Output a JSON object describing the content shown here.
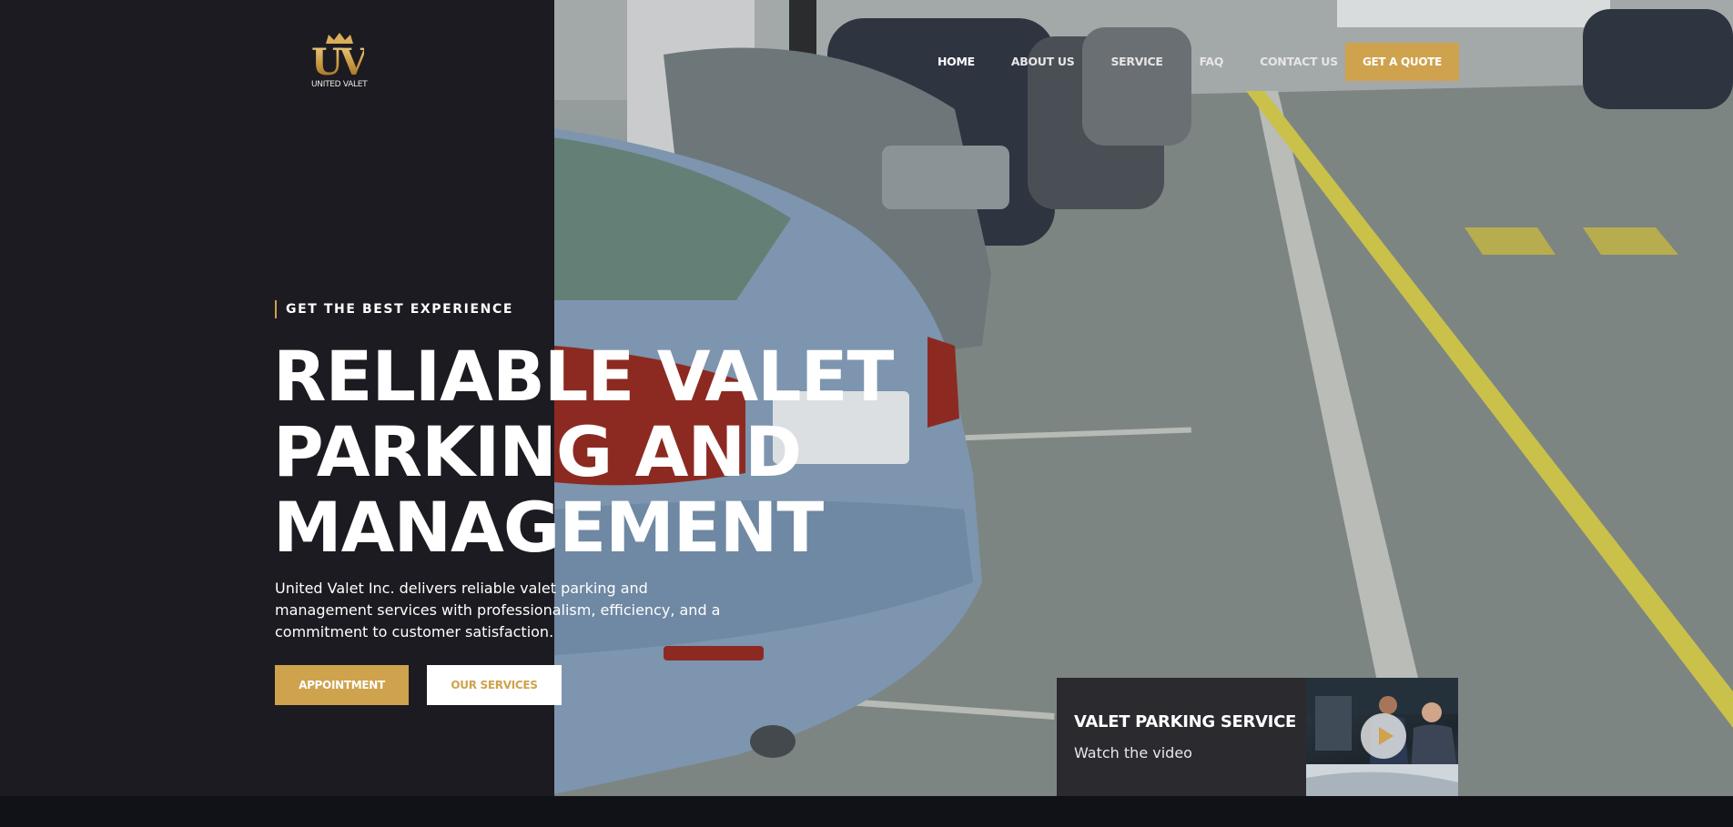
{
  "brand": {
    "logo_monogram": "UV",
    "logo_text": "UNITED VALET",
    "accent_color": "#cfa24d"
  },
  "nav": {
    "items": [
      {
        "label": "HOME",
        "active": true
      },
      {
        "label": "ABOUT US",
        "active": false
      },
      {
        "label": "SERVICE",
        "active": false
      },
      {
        "label": "FAQ",
        "active": false
      },
      {
        "label": "CONTACT US",
        "active": false
      }
    ],
    "cta_label": "GET A QUOTE"
  },
  "hero": {
    "eyebrow": "GET THE BEST EXPERIENCE",
    "headline_lines": [
      "RELIABLE VALET",
      "PARKING AND",
      "MANAGEMENT"
    ],
    "description": "United Valet Inc. delivers reliable valet parking and management services with professionalism, efficiency, and a commitment to customer satisfaction.",
    "primary_button": "APPOINTMENT",
    "secondary_button": "OUR SERVICES"
  },
  "video_card": {
    "title": "VALET PARKING SERVICE",
    "subtitle": "Watch the video",
    "play_icon": "play-icon"
  },
  "background_image": {
    "subject": "cars parked in a parking garage"
  }
}
